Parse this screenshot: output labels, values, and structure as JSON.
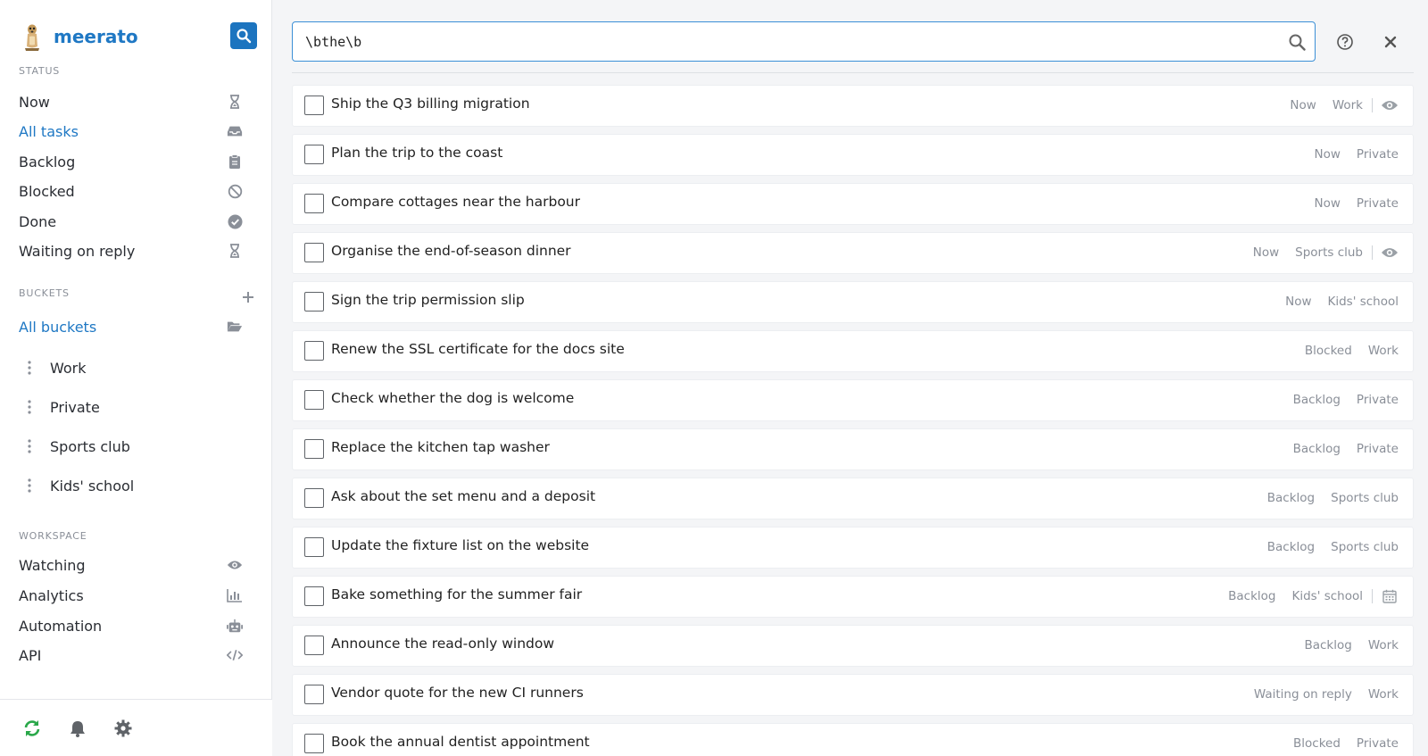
{
  "app": {
    "name": "meerato"
  },
  "sidebar": {
    "status_label": "STATUS",
    "status_items": [
      {
        "label": "Now",
        "icon": "hourglass-icon",
        "active": false
      },
      {
        "label": "All tasks",
        "icon": "inbox-icon",
        "active": true
      },
      {
        "label": "Backlog",
        "icon": "clipboard-icon",
        "active": false
      },
      {
        "label": "Blocked",
        "icon": "ban-icon",
        "active": false
      },
      {
        "label": "Done",
        "icon": "check-circle-icon",
        "active": false
      },
      {
        "label": "Waiting on reply",
        "icon": "hourglass-icon",
        "active": false
      }
    ],
    "buckets_label": "BUCKETS",
    "all_buckets": {
      "label": "All buckets",
      "icon": "folder-open-icon"
    },
    "buckets": [
      "Work",
      "Private",
      "Sports club",
      "Kids' school"
    ],
    "workspace_label": "WORKSPACE",
    "workspace_items": [
      {
        "label": "Watching",
        "icon": "eye-icon"
      },
      {
        "label": "Analytics",
        "icon": "bar-chart-icon"
      },
      {
        "label": "Automation",
        "icon": "robot-icon"
      },
      {
        "label": "API",
        "icon": "code-icon"
      }
    ],
    "footer_icons": [
      "sync-icon",
      "bell-icon",
      "gear-icon"
    ]
  },
  "search": {
    "value": "\\bthe\\b",
    "placeholder": ""
  },
  "colors": {
    "accent": "#1f78c4",
    "sync": "#2aa84a",
    "muted": "#8a8f98"
  },
  "tasks": [
    {
      "title": "Ship the Q3 billing migration",
      "status": "Now",
      "bucket": "Work",
      "icon": "eye-icon"
    },
    {
      "title": "Plan the trip to the coast",
      "status": "Now",
      "bucket": "Private",
      "icon": ""
    },
    {
      "title": "Compare cottages near the harbour",
      "status": "Now",
      "bucket": "Private",
      "icon": ""
    },
    {
      "title": "Organise the end-of-season dinner",
      "status": "Now",
      "bucket": "Sports club",
      "icon": "eye-icon"
    },
    {
      "title": "Sign the trip permission slip",
      "status": "Now",
      "bucket": "Kids' school",
      "icon": ""
    },
    {
      "title": "Renew the SSL certificate for the docs site",
      "status": "Blocked",
      "bucket": "Work",
      "icon": ""
    },
    {
      "title": "Check whether the dog is welcome",
      "status": "Backlog",
      "bucket": "Private",
      "icon": ""
    },
    {
      "title": "Replace the kitchen tap washer",
      "status": "Backlog",
      "bucket": "Private",
      "icon": ""
    },
    {
      "title": "Ask about the set menu and a deposit",
      "status": "Backlog",
      "bucket": "Sports club",
      "icon": ""
    },
    {
      "title": "Update the fixture list on the website",
      "status": "Backlog",
      "bucket": "Sports club",
      "icon": ""
    },
    {
      "title": "Bake something for the summer fair",
      "status": "Backlog",
      "bucket": "Kids' school",
      "icon": "calendar-icon"
    },
    {
      "title": "Announce the read-only window",
      "status": "Backlog",
      "bucket": "Work",
      "icon": ""
    },
    {
      "title": "Vendor quote for the new CI runners",
      "status": "Waiting on reply",
      "bucket": "Work",
      "icon": ""
    },
    {
      "title": "Book the annual dentist appointment",
      "status": "Blocked",
      "bucket": "Private",
      "icon": ""
    }
  ]
}
